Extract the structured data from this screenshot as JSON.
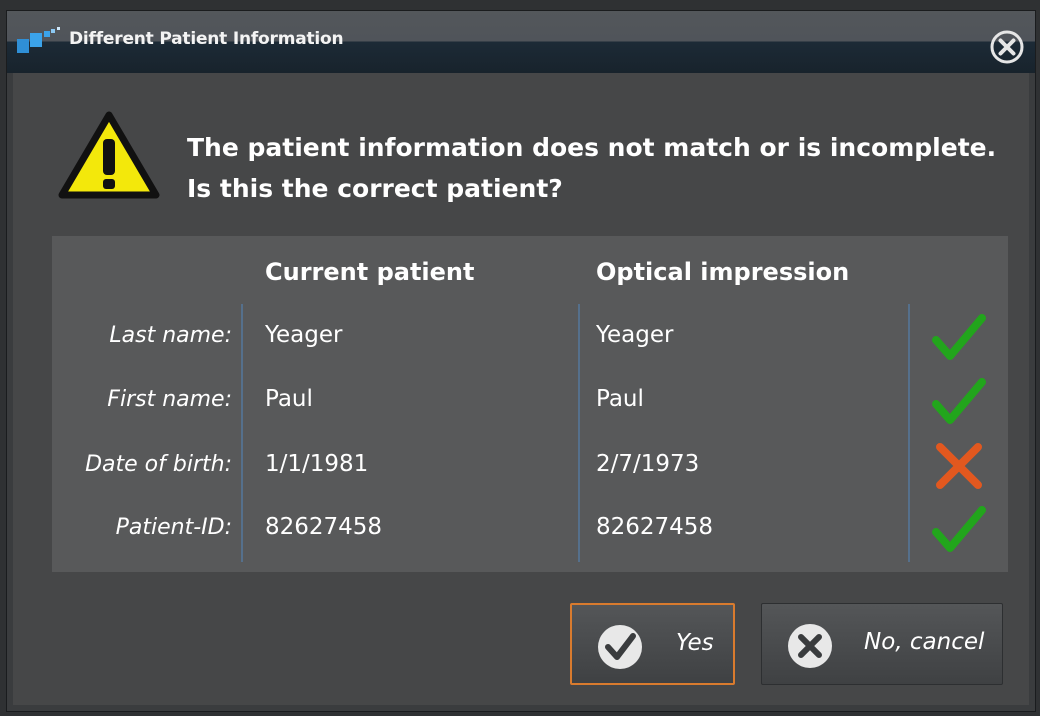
{
  "window": {
    "title": "Different Patient Information",
    "close_icon": "close-circle-icon",
    "app_icon": "app-logo-icon"
  },
  "message": {
    "icon": "warning-icon",
    "line1": "The patient information does not match or is incomplete.",
    "line2": "Is this the correct patient?"
  },
  "comparison": {
    "headers": {
      "current": "Current patient",
      "optical": "Optical impression"
    },
    "rows": [
      {
        "label": "Last name:",
        "current": "Yeager",
        "optical": "Yeager",
        "status": "match"
      },
      {
        "label": "First name:",
        "current": "Paul",
        "optical": "Paul",
        "status": "match"
      },
      {
        "label": "Date of birth:",
        "current": "1/1/1981",
        "optical": "2/7/1973",
        "status": "mismatch"
      },
      {
        "label": "Patient-ID:",
        "current": "82627458",
        "optical": "82627458",
        "status": "match"
      }
    ]
  },
  "buttons": {
    "yes": {
      "label": "Yes",
      "icon": "checkmark-circle-icon"
    },
    "no": {
      "label": "No, cancel",
      "icon": "x-circle-icon"
    }
  },
  "colors": {
    "match": "#22a51c",
    "mismatch": "#e2581f",
    "accent_border": "#d97b2e",
    "warning": "#f3e80b"
  }
}
